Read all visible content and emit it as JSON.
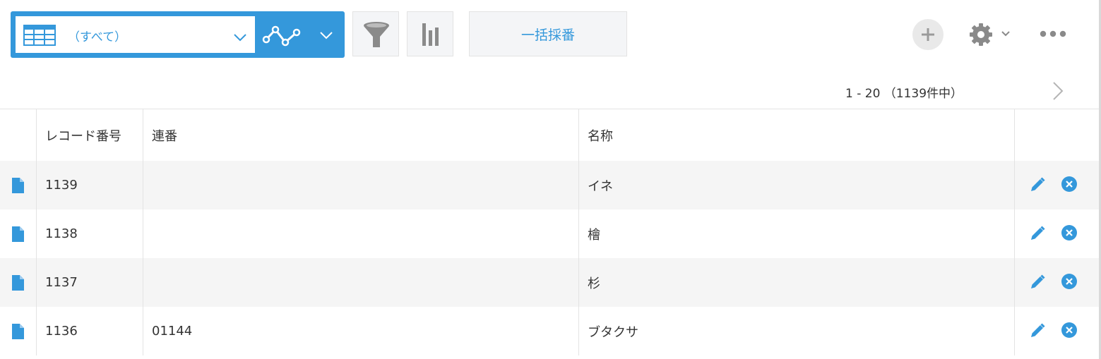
{
  "view": {
    "selected": "（すべて）"
  },
  "toolbar": {
    "batch_label": "一括採番"
  },
  "pager": {
    "text": "1 - 20 （1139件中）"
  },
  "table": {
    "columns": [
      "",
      "レコード番号",
      "連番",
      "名称",
      ""
    ],
    "rows": [
      {
        "record_no": "1139",
        "serial": "",
        "name": "イネ"
      },
      {
        "record_no": "1138",
        "serial": "",
        "name": "檜"
      },
      {
        "record_no": "1137",
        "serial": "",
        "name": "杉"
      },
      {
        "record_no": "1136",
        "serial": "01144",
        "name": "ブタクサ"
      }
    ]
  },
  "colors": {
    "accent": "#3498db",
    "row_alt": "#f5f5f5",
    "border": "#e3e3e3"
  },
  "icons": {
    "view_type": "table-grid-icon",
    "graph": "line-graph-icon",
    "filter": "funnel-icon",
    "chart": "bar-chart-icon",
    "add": "plus-icon",
    "settings": "gear-icon",
    "more": "ellipsis-icon",
    "next": "chevron-right-icon",
    "row_detail": "document-icon",
    "row_edit": "pencil-icon",
    "row_delete": "close-circle-icon"
  }
}
